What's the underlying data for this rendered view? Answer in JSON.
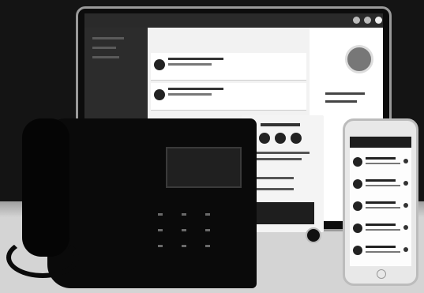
{
  "scene": {
    "description_items": [
      "laptop",
      "desk-phone",
      "smartphone"
    ]
  }
}
